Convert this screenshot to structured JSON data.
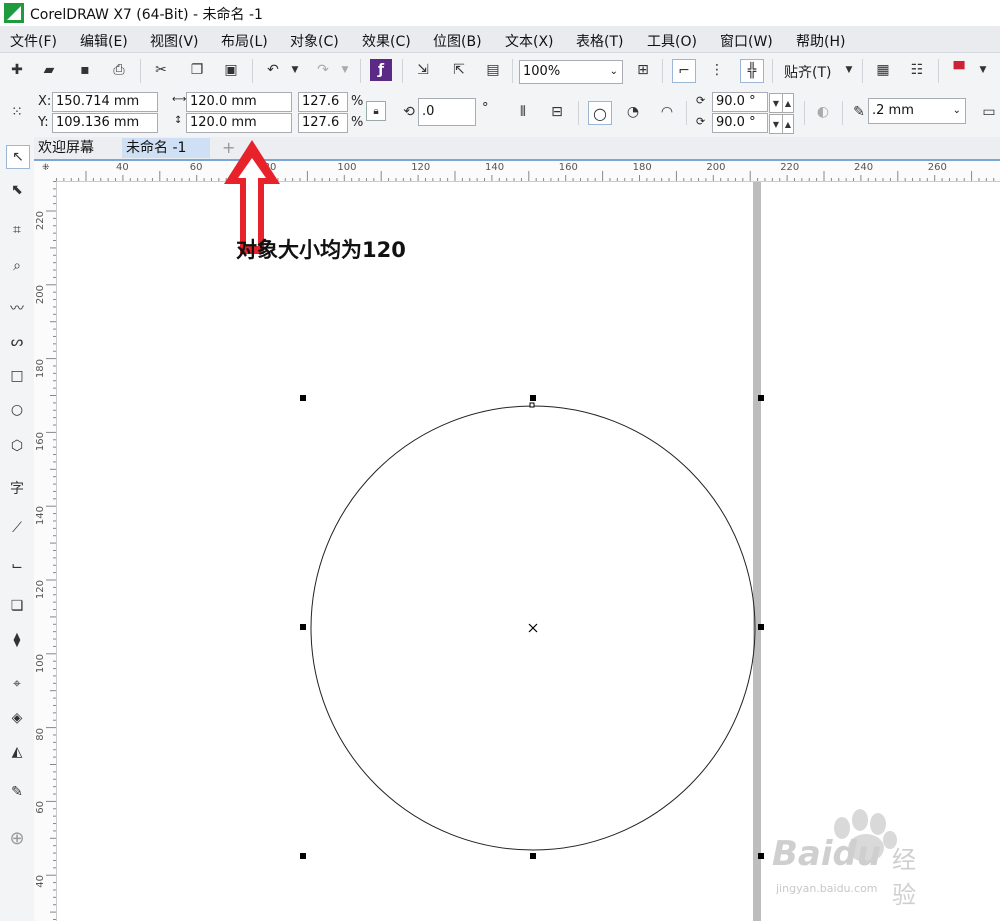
{
  "window": {
    "title": "CorelDRAW X7 (64-Bit) - 未命名 -1"
  },
  "menu": [
    {
      "label": "文件(F)"
    },
    {
      "label": "编辑(E)"
    },
    {
      "label": "视图(V)"
    },
    {
      "label": "布局(L)"
    },
    {
      "label": "对象(C)"
    },
    {
      "label": "效果(C)"
    },
    {
      "label": "位图(B)"
    },
    {
      "label": "文本(X)"
    },
    {
      "label": "表格(T)"
    },
    {
      "label": "工具(O)"
    },
    {
      "label": "窗口(W)"
    },
    {
      "label": "帮助(H)"
    }
  ],
  "toolbar": {
    "zoom": "100%",
    "snap_label": "贴齐(T)"
  },
  "properties": {
    "x_label": "X:",
    "x": "150.714 mm",
    "y_label": "Y:",
    "y": "109.136 mm",
    "width": "120.0 mm",
    "height": "120.0 mm",
    "scale_w": "127.6",
    "scale_h": "127.6",
    "percent": "%",
    "rotation": ".0",
    "degree": "°",
    "start_angle": "90.0 °",
    "end_angle": "90.0 °",
    "outline": ".2 mm"
  },
  "tabs": [
    {
      "label": "欢迎屏幕"
    },
    {
      "label": "未命名 -1"
    }
  ],
  "ruler": {
    "h_ticks": [
      "40",
      "60",
      "80",
      "100",
      "120",
      "140",
      "160",
      "180",
      "200",
      "220",
      "240",
      "260"
    ],
    "v_ticks": [
      "220",
      "200",
      "180",
      "160",
      "140",
      "120",
      "100",
      "80",
      "60",
      "40"
    ]
  },
  "annotation": {
    "text": "对象大小均为120",
    "color": "#e8222a"
  },
  "watermark": {
    "brand": "Baidu",
    "sub": "经验",
    "url": "jingyan.baidu.com"
  },
  "colors": {
    "accent": "#7aa7d8",
    "menubar": "#e9ebee",
    "arrow": "#e8222a"
  }
}
